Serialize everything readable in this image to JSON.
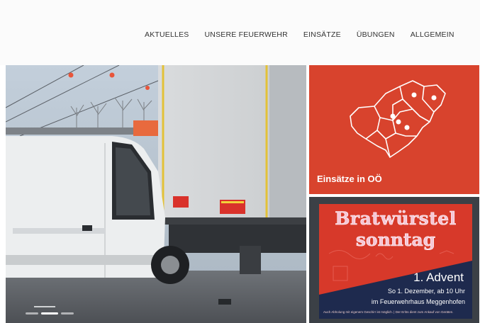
{
  "nav": {
    "items": [
      "AKTUELLES",
      "UNSERE FEUERWEHR",
      "EINSÄTZE",
      "ÜBUNGEN",
      "ALLGEMEIN"
    ]
  },
  "hero": {
    "slider_total": 3,
    "slider_active": 2
  },
  "tiles": {
    "einsaetze": {
      "label": "Einsätze in OÖ"
    },
    "event": {
      "title_line1": "Bratwürstel",
      "title_line2": "sonntag",
      "subtitle": "1. Advent",
      "date_line": "So 1. Dezember, ab 10 Uhr",
      "place_line": "im Feuerwehrhaus Meggenhofen",
      "fine_print": "Auch Abholung mit eigenem Geschirr ist möglich. | Der Erlös dient zum Ankauf von Geräten."
    }
  },
  "colors": {
    "accent_red": "#d8432d",
    "poster_red": "#d7392a",
    "poster_navy": "#1e2a4e",
    "dark_tile": "#3b4046"
  }
}
